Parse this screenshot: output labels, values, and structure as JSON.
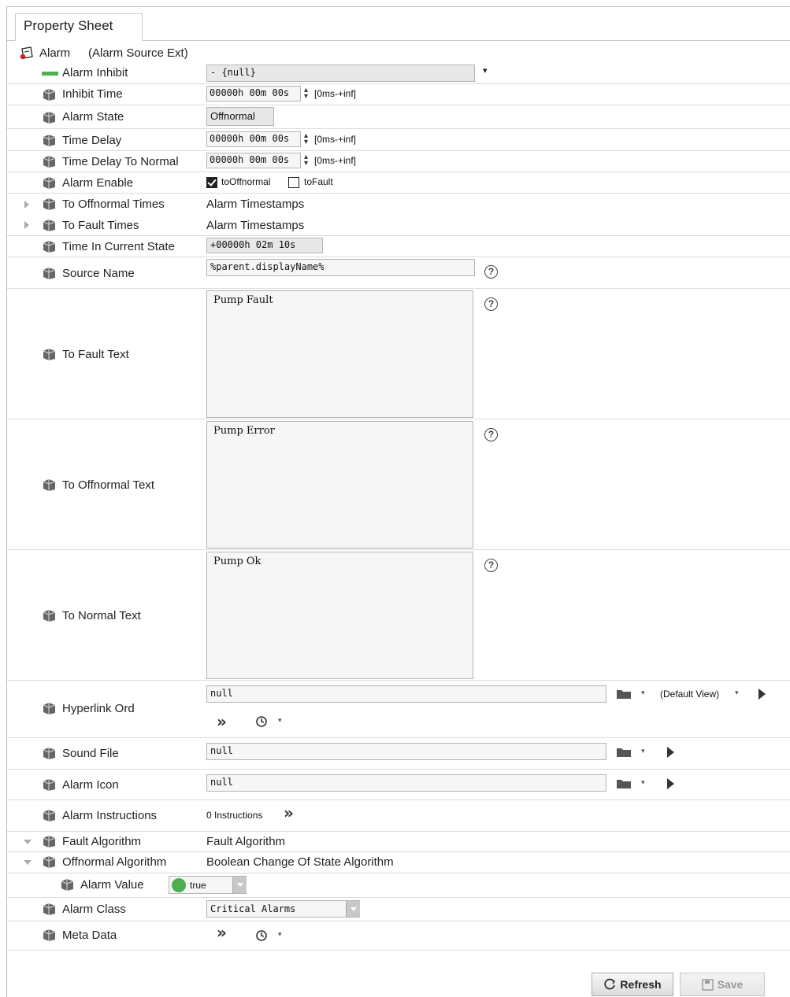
{
  "tab": {
    "label": "Property Sheet"
  },
  "root": {
    "name": "Alarm",
    "type": "(Alarm Source Ext)"
  },
  "rows": {
    "alarm_inhibit": {
      "label": "Alarm Inhibit",
      "value": "- {null}"
    },
    "inhibit_time": {
      "label": "Inhibit Time",
      "value": "00000h 00m 00s",
      "range": "[0ms-+inf]"
    },
    "alarm_state": {
      "label": "Alarm State",
      "value": "Offnormal"
    },
    "time_delay": {
      "label": "Time Delay",
      "value": "00000h 00m 00s",
      "range": "[0ms-+inf]"
    },
    "time_delay_to_normal": {
      "label": "Time Delay To Normal",
      "value": "00000h 00m 00s",
      "range": "[0ms-+inf]"
    },
    "alarm_enable": {
      "label": "Alarm Enable",
      "opt1": "toOffnormal",
      "opt1_checked": true,
      "opt2": "toFault",
      "opt2_checked": false
    },
    "to_offnormal_times": {
      "label": "To Offnormal Times",
      "value": "Alarm Timestamps"
    },
    "to_fault_times": {
      "label": "To Fault Times",
      "value": "Alarm Timestamps"
    },
    "time_in_current_state": {
      "label": "Time In Current State",
      "value": "+00000h 02m 10s"
    },
    "source_name": {
      "label": "Source Name",
      "value": "%parent.displayName%"
    },
    "to_fault_text": {
      "label": "To Fault Text",
      "value": "Pump Fault"
    },
    "to_offnormal_text": {
      "label": "To Offnormal Text",
      "value": "Pump Error"
    },
    "to_normal_text": {
      "label": "To Normal Text",
      "value": "Pump Ok"
    },
    "hyperlink_ord": {
      "label": "Hyperlink Ord",
      "value": "null",
      "view": "(Default View)"
    },
    "sound_file": {
      "label": "Sound File",
      "value": "null"
    },
    "alarm_icon": {
      "label": "Alarm Icon",
      "value": "null"
    },
    "alarm_instructions": {
      "label": "Alarm Instructions",
      "value": "0 Instructions"
    },
    "fault_algorithm": {
      "label": "Fault Algorithm",
      "value": "Fault Algorithm"
    },
    "offnormal_algorithm": {
      "label": "Offnormal Algorithm",
      "value": "Boolean Change Of State Algorithm"
    },
    "alarm_value": {
      "label": "Alarm Value",
      "value": "true"
    },
    "alarm_class": {
      "label": "Alarm Class",
      "value": "Critical Alarms"
    },
    "meta_data": {
      "label": "Meta Data"
    }
  },
  "buttons": {
    "refresh": "Refresh",
    "save": "Save"
  },
  "colors": {
    "inhibit_bar": "#4caf50",
    "true_dot": "#4caf50",
    "alarm_icon_red": "#cc2222"
  },
  "icons": {
    "slot": "component-icon",
    "help": "help-icon",
    "folder": "folder-icon",
    "play": "play-icon",
    "history": "history-icon",
    "chevrons": "double-chevron-icon"
  }
}
